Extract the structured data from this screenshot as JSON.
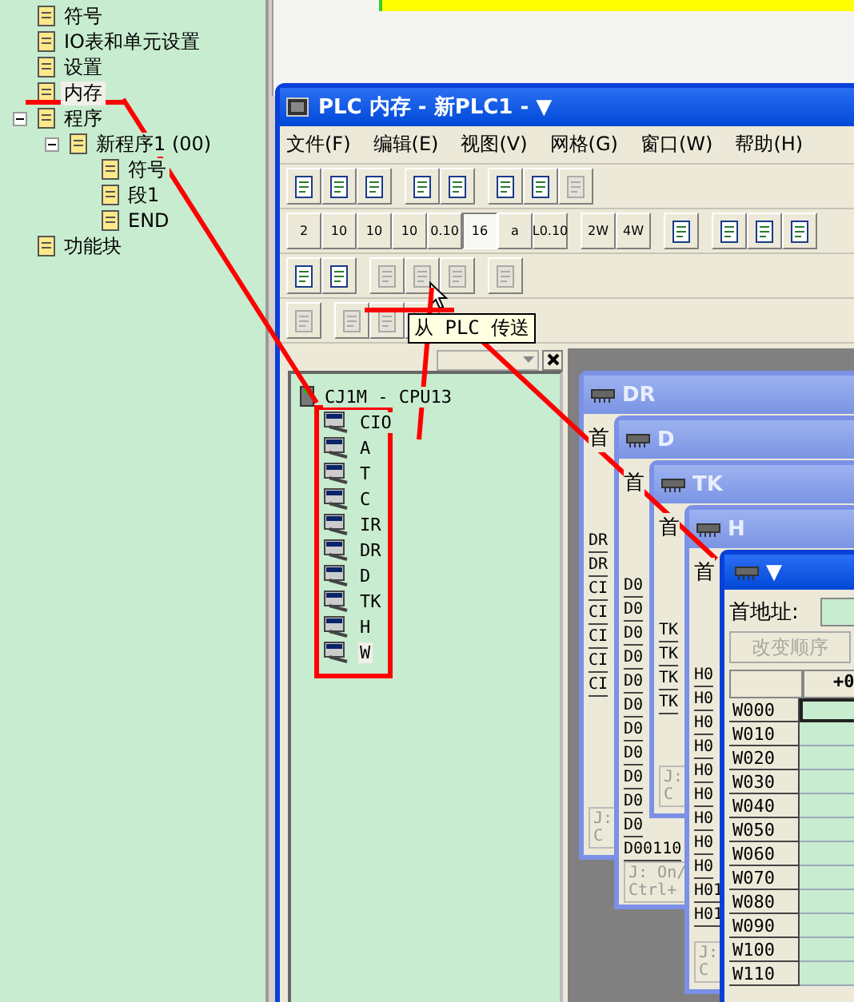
{
  "tree": {
    "items": [
      {
        "label": "符号",
        "selected": false
      },
      {
        "label": "IO表和单元设置",
        "selected": false
      },
      {
        "label": "设置",
        "selected": false
      },
      {
        "label": "内存",
        "selected": true
      },
      {
        "label": "程序",
        "selected": false,
        "expanded": true,
        "children": [
          {
            "label": "新程序1 (00)",
            "selected": false,
            "expanded": true,
            "children": [
              {
                "label": "符号",
                "selected": false
              },
              {
                "label": "段1",
                "selected": false
              },
              {
                "label": "END",
                "selected": false
              }
            ]
          }
        ]
      },
      {
        "label": "功能块",
        "selected": false
      }
    ]
  },
  "window": {
    "title": "PLC 内存 - 新PLC1 - ▼"
  },
  "menu": [
    "文件(F)",
    "编辑(E)",
    "视图(V)",
    "网格(G)",
    "窗口(W)",
    "帮助(H)"
  ],
  "toolbars": [
    [
      [
        {
          "kind": "icon",
          "disabled": false
        },
        {
          "kind": "icon",
          "disabled": false
        },
        {
          "kind": "icon",
          "disabled": false
        }
      ],
      [
        {
          "kind": "icon",
          "disabled": false
        },
        {
          "kind": "icon",
          "disabled": false
        }
      ],
      [
        {
          "kind": "icon",
          "disabled": false
        },
        {
          "kind": "icon",
          "disabled": false
        },
        {
          "kind": "icon",
          "disabled": true
        }
      ]
    ],
    [
      [
        {
          "kind": "text",
          "label": "2",
          "selected": false
        },
        {
          "kind": "text",
          "label": "10",
          "selected": false
        },
        {
          "kind": "text",
          "label": "10",
          "selected": false
        },
        {
          "kind": "text",
          "label": "10",
          "selected": false
        },
        {
          "kind": "text",
          "label": "0.10",
          "selected": false
        },
        {
          "kind": "text",
          "label": "16",
          "selected": true
        },
        {
          "kind": "text",
          "label": "a",
          "selected": false
        },
        {
          "kind": "text",
          "label": "L0.10",
          "selected": false
        }
      ],
      [
        {
          "kind": "text",
          "label": "2W",
          "selected": false
        },
        {
          "kind": "text",
          "label": "4W",
          "selected": false
        }
      ],
      [
        {
          "kind": "icon",
          "disabled": false
        }
      ],
      [
        {
          "kind": "icon",
          "disabled": false
        },
        {
          "kind": "icon",
          "disabled": false
        },
        {
          "kind": "icon",
          "disabled": false
        }
      ]
    ],
    [
      [
        {
          "kind": "icon",
          "disabled": false
        },
        {
          "kind": "icon",
          "disabled": false
        }
      ],
      [
        {
          "kind": "icon",
          "disabled": true
        },
        {
          "kind": "icon",
          "disabled": true
        },
        {
          "kind": "icon",
          "disabled": true
        }
      ],
      [
        {
          "kind": "icon",
          "disabled": true
        }
      ]
    ],
    [
      [
        {
          "kind": "icon",
          "disabled": true
        }
      ],
      [
        {
          "kind": "icon",
          "disabled": true
        },
        {
          "kind": "icon",
          "disabled": true
        },
        {
          "kind": "icon",
          "disabled": true
        }
      ]
    ]
  ],
  "tooltip": "从 PLC 传送",
  "memory_tree": {
    "root": "CJ1M - CPU13",
    "items": [
      {
        "label": "CIO",
        "selected": false
      },
      {
        "label": "A",
        "selected": false
      },
      {
        "label": "T",
        "selected": false
      },
      {
        "label": "C",
        "selected": false
      },
      {
        "label": "IR",
        "selected": false
      },
      {
        "label": "DR",
        "selected": false
      },
      {
        "label": "D",
        "selected": false
      },
      {
        "label": "TK",
        "selected": false
      },
      {
        "label": "H",
        "selected": false
      },
      {
        "label": "W",
        "selected": true
      }
    ]
  },
  "memory_windows": [
    {
      "title": "DR",
      "label": "首",
      "rows": [
        "DR",
        "DR",
        "CI",
        "CI",
        "CI",
        "CI",
        "CI"
      ],
      "footer": [
        "J:",
        "C"
      ]
    },
    {
      "title": "D",
      "label": "首",
      "rows": [
        "D0",
        "D0",
        "D0",
        "D0",
        "D0",
        "D0",
        "D0",
        "D0",
        "D0",
        "D0",
        "D0",
        "D00110"
      ],
      "footer": [
        "J: On/",
        "Ctrl+"
      ]
    },
    {
      "title": "TK",
      "label": "首",
      "rows": [
        "TK",
        "TK",
        "TK",
        "TK"
      ],
      "footer": [
        "J:",
        "C"
      ]
    },
    {
      "title": "H",
      "label": "首",
      "rows": [
        "H0",
        "H0",
        "H0",
        "H0",
        "H0",
        "H0",
        "H0",
        "H0",
        "H0",
        "H01",
        "H01"
      ],
      "footer": [
        "J:",
        "C"
      ]
    }
  ],
  "active_window": {
    "title": "▼",
    "address_label": "首地址:",
    "button": {
      "label": "改变顺序",
      "disabled": true
    },
    "columns": [
      "+0"
    ],
    "rows": [
      {
        "label": "W000",
        "selected": true
      },
      {
        "label": "W010",
        "selected": false
      },
      {
        "label": "W020",
        "selected": false
      },
      {
        "label": "W030",
        "selected": false
      },
      {
        "label": "W040",
        "selected": false
      },
      {
        "label": "W050",
        "selected": false
      },
      {
        "label": "W060",
        "selected": false
      },
      {
        "label": "W070",
        "selected": false
      },
      {
        "label": "W080",
        "selected": false
      },
      {
        "label": "W090",
        "selected": false
      },
      {
        "label": "W100",
        "selected": false
      },
      {
        "label": "W110",
        "selected": false
      }
    ]
  }
}
